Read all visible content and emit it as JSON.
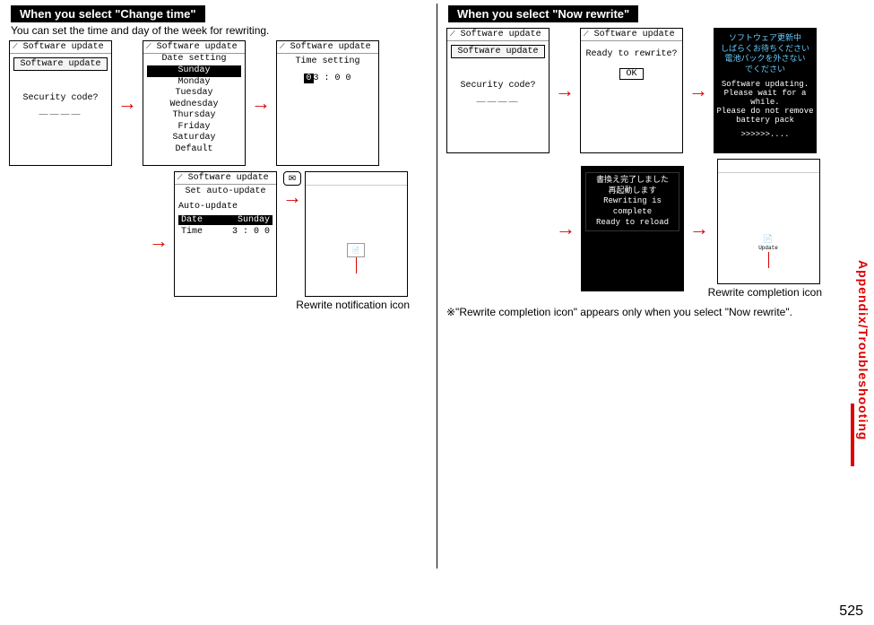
{
  "pageNumber": "525",
  "sideTab": "Appendix/Troubleshooting",
  "left": {
    "title": "When you select \"Change time\"",
    "desc": "You can set the time and day of the week for rewriting.",
    "screens": {
      "s1": {
        "hdr": "Software update",
        "title": "Software update",
        "line1": "Security code?",
        "input": "＿＿＿＿"
      },
      "s2": {
        "hdr": "Software update",
        "title": "Date setting",
        "days": [
          "Sunday",
          "Monday",
          "Tuesday",
          "Wednesday",
          "Thursday",
          "Friday",
          "Saturday",
          "Default"
        ]
      },
      "s3": {
        "hdr": "Software update",
        "title": "Time setting",
        "time_a": "0",
        "time_b": "3 : 0 0"
      },
      "s4": {
        "hdr": "Software update",
        "title": "Set auto-update",
        "label": "Auto-update",
        "dateLabel": "Date",
        "dateVal": "Sunday",
        "timeLabel": "Time",
        "timeVal": "3 : 0 0"
      }
    },
    "mailIcon": "✉",
    "notifyIconLabel": "Rewrite notification icon"
  },
  "right": {
    "title": "When you select \"Now rewrite\"",
    "screens": {
      "s1": {
        "hdr": "Software update",
        "title": "Software update",
        "line1": "Security code?",
        "input": "＿＿＿＿"
      },
      "s2": {
        "hdr": "Software update",
        "line1": "Ready to rewrite?",
        "ok": "OK"
      },
      "s3": {
        "jp1": "ソフトウェア更新中",
        "jp2": "しばらくお待ちください",
        "jp3": "電池パックを外さない",
        "jp4": "でください",
        "en1": "Software updating.",
        "en2": "Please wait for a while.",
        "en3": "Please do not remove",
        "en4": "battery pack",
        "dots": ">>>>>>...."
      },
      "s4": {
        "jp1": "書換え完了しました",
        "jp2": "再起動します",
        "en1": "Rewriting is complete",
        "en2": "Ready to reload"
      },
      "s5": {
        "iconLabel": "Update"
      }
    },
    "completionLabel": "Rewrite completion icon",
    "note": "※\"Rewrite completion icon\" appears only when you select \"Now rewrite\"."
  }
}
